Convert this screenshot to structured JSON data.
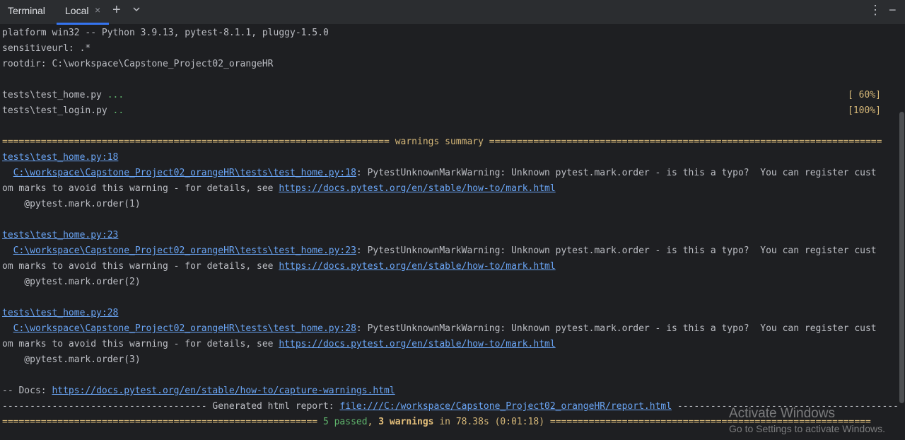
{
  "tabbar": {
    "title": "Terminal",
    "tab_label": "Local",
    "close_glyph": "×",
    "plus_glyph": "+",
    "kebab_glyph": "⋮",
    "minimize_glyph": "−"
  },
  "terminal": {
    "l1": "platform win32 -- Python 3.9.13, pytest-8.1.1, pluggy-1.5.0",
    "l2": "sensitiveurl: .*",
    "l3": "rootdir: C:\\workspace\\Capstone_Project02_orangeHR",
    "test1": {
      "file": "tests\\test_home.py ",
      "dots": "...",
      "pct": "[ 60%]"
    },
    "test2": {
      "file": "tests\\test_login.py ",
      "dots": "..",
      "pct": "[100%]"
    },
    "summary_header": "====================================================================== warnings summary =======================================================================",
    "w1": {
      "ref": "tests\\test_home.py:18",
      "path": "C:\\workspace\\Capstone_Project02_orangeHR\\tests\\test_home.py:18",
      "msg": ": PytestUnknownMarkWarning: Unknown pytest.mark.order - is this a typo?  You can register cust",
      "msg2": "om marks to avoid this warning - for details, see ",
      "url": "https://docs.pytest.org/en/stable/how-to/mark.html",
      "deco": "    @pytest.mark.order(1)"
    },
    "w2": {
      "ref": "tests\\test_home.py:23",
      "path": "C:\\workspace\\Capstone_Project02_orangeHR\\tests\\test_home.py:23",
      "msg": ": PytestUnknownMarkWarning: Unknown pytest.mark.order - is this a typo?  You can register cust",
      "msg2": "om marks to avoid this warning - for details, see ",
      "url": "https://docs.pytest.org/en/stable/how-to/mark.html",
      "deco": "    @pytest.mark.order(2)"
    },
    "w3": {
      "ref": "tests\\test_home.py:28",
      "path": "C:\\workspace\\Capstone_Project02_orangeHR\\tests\\test_home.py:28",
      "msg": ": PytestUnknownMarkWarning: Unknown pytest.mark.order - is this a typo?  You can register cust",
      "msg2": "om marks to avoid this warning - for details, see ",
      "url": "https://docs.pytest.org/en/stable/how-to/mark.html",
      "deco": "    @pytest.mark.order(3)"
    },
    "docs_prefix": "-- Docs: ",
    "docs_url": "https://docs.pytest.org/en/stable/how-to/capture-warnings.html",
    "report_prefix": "------------------------------------- Generated html report: ",
    "report_url": "file:///C:/workspace/Capstone_Project02_orangeHR/report.html",
    "report_suffix": " -------------------------------------------",
    "final_left": "========================================================= ",
    "passed": "5 passed",
    "comma": ", ",
    "warnings": "3 warnings",
    "final_time": " in 78.38s (0:01:18) ",
    "final_right": "=========================================================="
  },
  "watermark": {
    "line1": "Activate Windows",
    "line2": "Go to Settings to activate Windows."
  },
  "colors": {
    "background": "#1e1f22",
    "tabbar": "#2b2d30",
    "text": "#bcbec4",
    "accent": "#3574f0",
    "yellow": "#d5b778",
    "green": "#5fb56c",
    "link": "#6aa5f5"
  }
}
